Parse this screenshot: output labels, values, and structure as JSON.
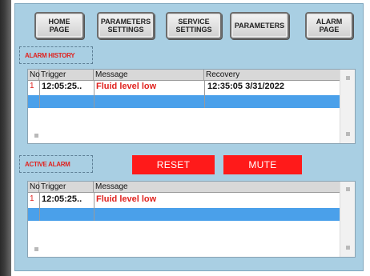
{
  "nav": {
    "home": [
      "HOME",
      "PAGE"
    ],
    "param_settings": [
      "PARAMETERS",
      "SETTINGS"
    ],
    "service_settings": [
      "SERVICE",
      "SETTINGS"
    ],
    "parameters": "PARAMETERS",
    "alarm_page": [
      "ALARM",
      "PAGE"
    ]
  },
  "alarm_history": {
    "label": "ALARM HISTORY",
    "columns": [
      "No",
      "Trigger",
      "Message",
      "Recovery"
    ],
    "rows": [
      {
        "no": "1",
        "trigger": "12:05:25..",
        "message": "Fluid level low",
        "recovery": "12:35:05 3/31/2022"
      }
    ]
  },
  "active_alarm": {
    "label": "ACTIVE ALARM",
    "reset_label": "RESET",
    "mute_label": "MUTE",
    "columns": [
      "No",
      "Trigger",
      "Message"
    ],
    "rows": [
      {
        "no": "1",
        "trigger": "12:05:25..",
        "message": "Fluid level low"
      }
    ]
  },
  "colors": {
    "panel_bg": "#a9cfe3",
    "alarm_red": "#ff1a1a",
    "selected_row": "#4aa0ea"
  }
}
